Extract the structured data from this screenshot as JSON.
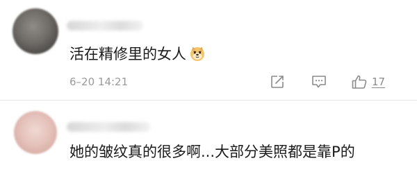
{
  "comments": [
    {
      "text": "活在精修里的女人",
      "emoji": "doge-emoji",
      "timestamp": "6–20 14:21",
      "actions": {
        "share_icon": "share-icon",
        "comment_icon": "comment-icon",
        "like_icon": "thumbs-up-icon",
        "like_count": "17"
      }
    },
    {
      "text": "她的皱纹真的很多啊...大部分美照都是靠P的"
    }
  ],
  "colors": {
    "text": "#1a1a1a",
    "meta": "#9a9a9a",
    "divider": "#e6e6e6"
  }
}
